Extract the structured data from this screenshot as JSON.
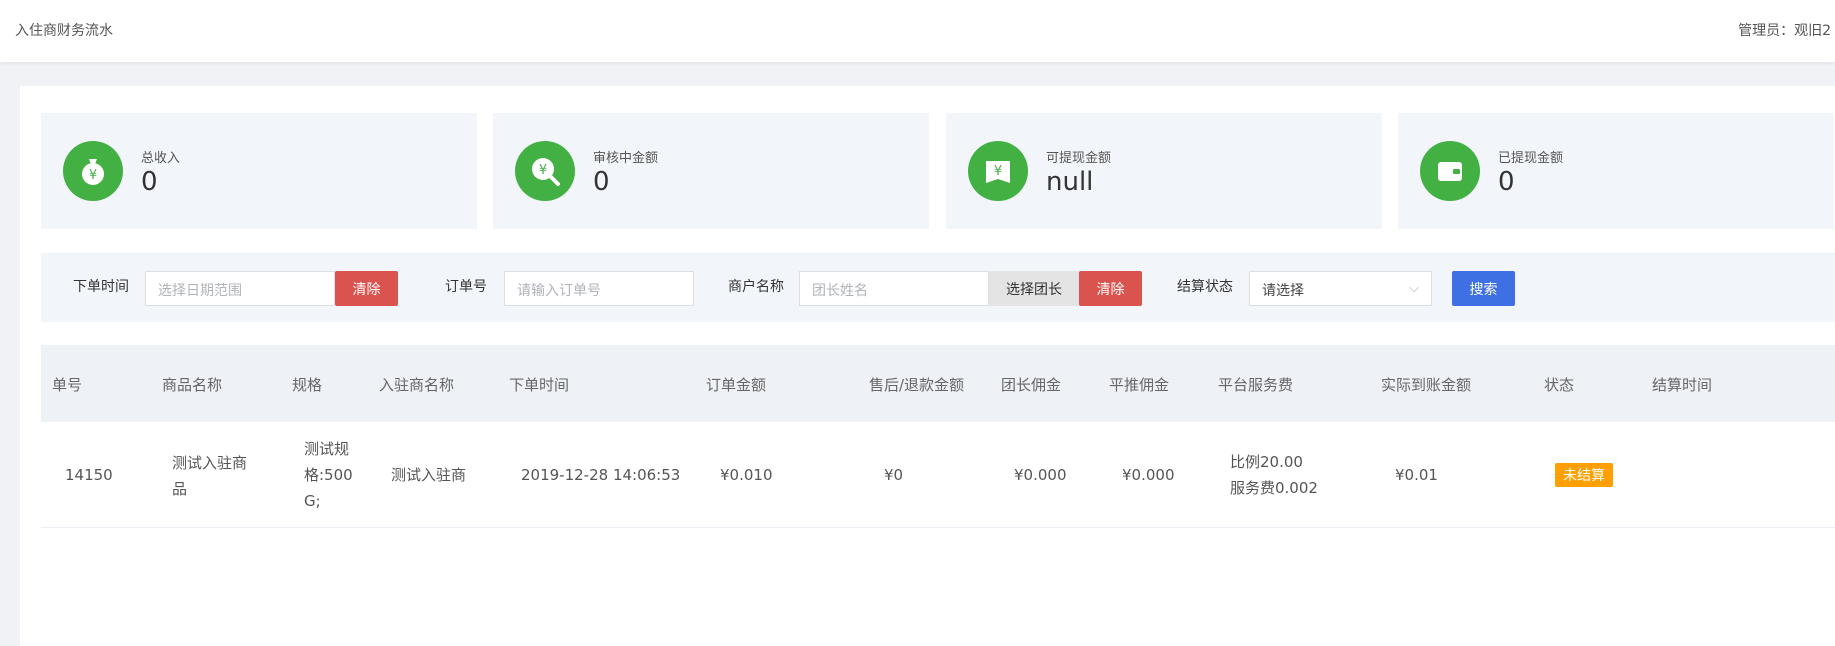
{
  "header": {
    "title": "入住商财务流水",
    "admin_label": "管理员：",
    "admin_name": "观旧2"
  },
  "stats": [
    {
      "label": "总收入",
      "value": "0",
      "icon": "money-bag-icon"
    },
    {
      "label": "审核中金额",
      "value": "0",
      "icon": "money-search-icon"
    },
    {
      "label": "可提现金额",
      "value": "null",
      "icon": "money-book-icon"
    },
    {
      "label": "已提现金额",
      "value": "0",
      "icon": "wallet-icon"
    }
  ],
  "filters": {
    "order_time_label": "下单时间",
    "order_time_placeholder": "选择日期范围",
    "clear_label": "清除",
    "order_no_label": "订单号",
    "order_no_placeholder": "请输入订单号",
    "merchant_label": "商户名称",
    "merchant_placeholder": "团长姓名",
    "select_leader_label": "选择团长",
    "clear2_label": "清除",
    "status_label": "结算状态",
    "status_value": "请选择",
    "search_label": "搜索"
  },
  "table": {
    "headers": [
      "单号",
      "商品名称",
      "规格",
      "入驻商名称",
      "下单时间",
      "订单金额",
      "售后/退款金额",
      "团长佣金",
      "平推佣金",
      "平台服务费",
      "实际到账金额",
      "状态",
      "结算时间"
    ],
    "rows": [
      {
        "id": "14150",
        "product": "测试入驻商品",
        "spec": "测试规格:500G;",
        "merchant": "测试入驻商",
        "order_time": "2019-12-28 14:06:53",
        "amount": "¥0.010",
        "refund": "¥0",
        "leader_commission": "¥0.000",
        "push_commission": "¥0.000",
        "fee_ratio": "比例20.00",
        "fee_amount": "服务费0.002",
        "actual": "¥0.01",
        "status": "未结算",
        "settle_time": ""
      }
    ]
  },
  "colors": {
    "accent_green": "#43b043",
    "danger": "#d9534f",
    "primary": "#3e6fe3",
    "warning": "#ff9f00"
  }
}
